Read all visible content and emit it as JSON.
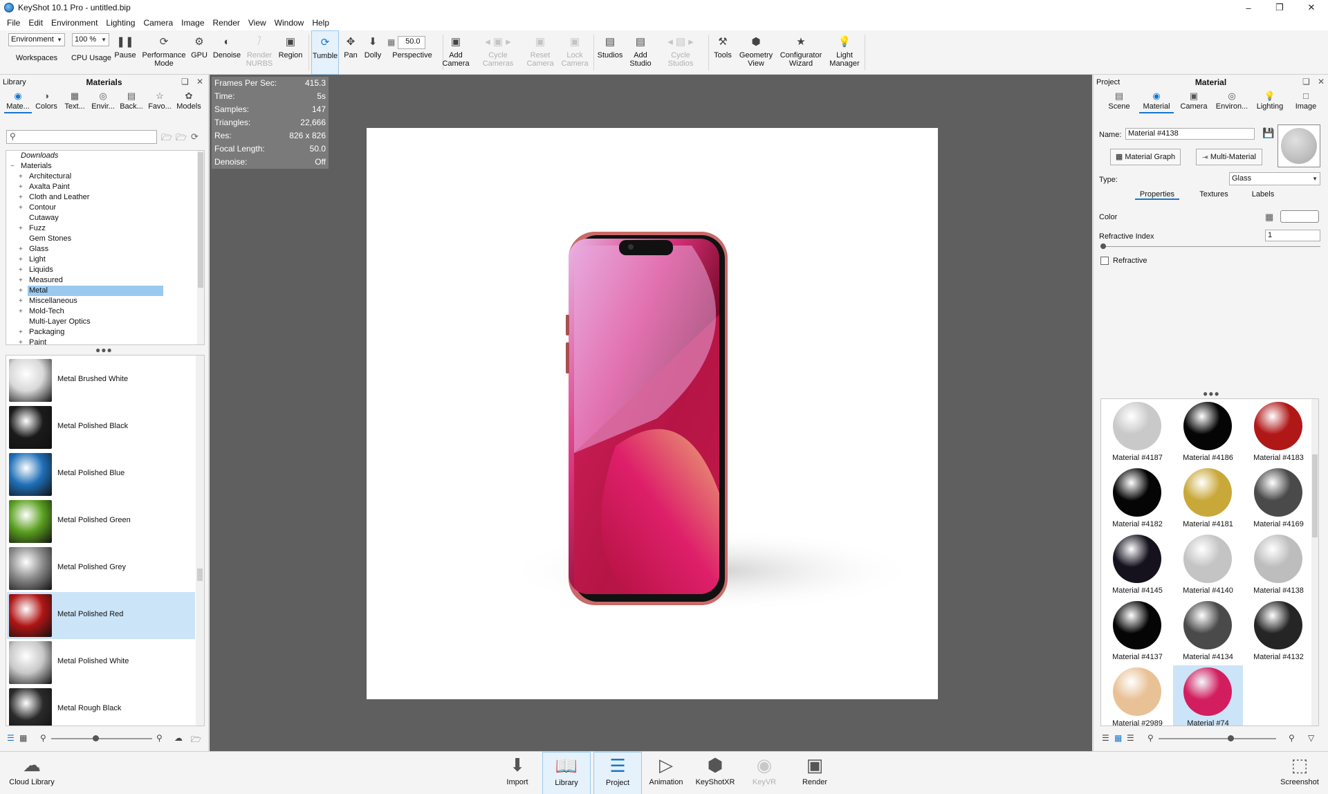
{
  "window": {
    "title": "KeyShot 10.1 Pro  - untitled.bip"
  },
  "menu": [
    "File",
    "Edit",
    "Environment",
    "Lighting",
    "Camera",
    "Image",
    "Render",
    "View",
    "Window",
    "Help"
  ],
  "toolbar": {
    "workspace_select": "Environment",
    "workspace_label": "Workspaces",
    "cpu_select": "100 %",
    "cpu_label": "CPU Usage",
    "pause": "Pause",
    "performance_mode": "Performance Mode",
    "gpu": "GPU",
    "denoise": "Denoise",
    "render_nurbs": "Render NURBS",
    "region": "Region",
    "tumble": "Tumble",
    "pan": "Pan",
    "dolly": "Dolly",
    "perspective_value": "50.0",
    "perspective": "Perspective",
    "add_camera": "Add Camera",
    "cycle_cameras": "Cycle Cameras",
    "reset_camera": "Reset Camera",
    "lock_camera": "Lock Camera",
    "studios": "Studios",
    "add_studio": "Add Studio",
    "cycle_studios": "Cycle Studios",
    "tools": "Tools",
    "geometry_view": "Geometry View",
    "configurator_wizard": "Configurator Wizard",
    "light_manager": "Light Manager"
  },
  "library": {
    "panel_label": "Library",
    "title": "Materials",
    "tabs": [
      "Mate...",
      "Colors",
      "Text...",
      "Envir...",
      "Back...",
      "Favo...",
      "Models"
    ],
    "tree": [
      {
        "label": "Downloads",
        "expand": "",
        "indent": 0,
        "italic": true
      },
      {
        "label": "Materials",
        "expand": "−",
        "indent": 0
      },
      {
        "label": "Architectural",
        "expand": "+",
        "indent": 1
      },
      {
        "label": "Axalta Paint",
        "expand": "+",
        "indent": 1
      },
      {
        "label": "Cloth and Leather",
        "expand": "+",
        "indent": 1
      },
      {
        "label": "Contour",
        "expand": "+",
        "indent": 1
      },
      {
        "label": "Cutaway",
        "expand": "",
        "indent": 1
      },
      {
        "label": "Fuzz",
        "expand": "+",
        "indent": 1
      },
      {
        "label": "Gem Stones",
        "expand": "",
        "indent": 1
      },
      {
        "label": "Glass",
        "expand": "+",
        "indent": 1
      },
      {
        "label": "Light",
        "expand": "+",
        "indent": 1
      },
      {
        "label": "Liquids",
        "expand": "+",
        "indent": 1
      },
      {
        "label": "Measured",
        "expand": "+",
        "indent": 1
      },
      {
        "label": "Metal",
        "expand": "+",
        "indent": 1,
        "selected": true
      },
      {
        "label": "Miscellaneous",
        "expand": "+",
        "indent": 1
      },
      {
        "label": "Mold-Tech",
        "expand": "+",
        "indent": 1
      },
      {
        "label": "Multi-Layer Optics",
        "expand": "",
        "indent": 1
      },
      {
        "label": "Packaging",
        "expand": "+",
        "indent": 1
      },
      {
        "label": "Paint",
        "expand": "+",
        "indent": 1
      }
    ],
    "materials": [
      {
        "name": "Metal Brushed White",
        "color": "#d8d8d8"
      },
      {
        "name": "Metal Polished Black",
        "color": "#1a1a1a"
      },
      {
        "name": "Metal Polished Blue",
        "color": "#1f6fb8"
      },
      {
        "name": "Metal Polished Green",
        "color": "#5aa020"
      },
      {
        "name": "Metal Polished Grey",
        "color": "#8a8a8a"
      },
      {
        "name": "Metal Polished Red",
        "color": "#b01515",
        "selected": true
      },
      {
        "name": "Metal Polished White",
        "color": "#c8c8c8"
      },
      {
        "name": "Metal Rough Black",
        "color": "#2a2a2a"
      }
    ]
  },
  "stats": [
    {
      "k": "Frames Per Sec:",
      "v": "415.3"
    },
    {
      "k": "Time:",
      "v": "5s"
    },
    {
      "k": "Samples:",
      "v": "147"
    },
    {
      "k": "Triangles:",
      "v": "22,666"
    },
    {
      "k": "Res:",
      "v": "826 x 826"
    },
    {
      "k": "Focal Length:",
      "v": "50.0"
    },
    {
      "k": "Denoise:",
      "v": "Off"
    }
  ],
  "project": {
    "panel_label": "Project",
    "title": "Material",
    "tabs": [
      "Scene",
      "Material",
      "Camera",
      "Environ...",
      "Lighting",
      "Image"
    ],
    "name_label": "Name:",
    "name_value": "Material #4138",
    "material_graph": "Material Graph",
    "multi_material": "Multi-Material",
    "type_label": "Type:",
    "type_value": "Glass",
    "subtabs": [
      "Properties",
      "Textures",
      "Labels"
    ],
    "color_label": "Color",
    "refractive_index_label": "Refractive Index",
    "refractive_index_value": "1",
    "refractive_label": "Refractive",
    "materials": [
      {
        "name": "Material #4187",
        "color": "#c9c9c9"
      },
      {
        "name": "Material #4186",
        "color": "#050505"
      },
      {
        "name": "Material #4183",
        "color": "#b01818"
      },
      {
        "name": "Material #4182",
        "color": "#050505"
      },
      {
        "name": "Material #4181",
        "color": "#c9a83a"
      },
      {
        "name": "Material #4169",
        "color": "#4a4a4a"
      },
      {
        "name": "Material #4145",
        "color": "#15121e"
      },
      {
        "name": "Material #4140",
        "color": "#c4c4c4"
      },
      {
        "name": "Material #4138",
        "color": "#bdbdbd"
      },
      {
        "name": "Material #4137",
        "color": "#050505"
      },
      {
        "name": "Material #4134",
        "color": "#4a4a4a"
      },
      {
        "name": "Material #4132",
        "color": "#252525"
      },
      {
        "name": "Material #2989",
        "color": "#e8c196"
      },
      {
        "name": "Material #74",
        "color": "#d21e5e",
        "selected": true
      }
    ]
  },
  "bottom": {
    "cloud_library": "Cloud Library",
    "import": "Import",
    "library": "Library",
    "project": "Project",
    "animation": "Animation",
    "keyshotxr": "KeyShotXR",
    "keyvr": "KeyVR",
    "render": "Render",
    "screenshot": "Screenshot"
  },
  "colors": {
    "accent": "#1477cc",
    "selection": "#cce4f7",
    "viewport_bg": "#5f5f5f"
  }
}
